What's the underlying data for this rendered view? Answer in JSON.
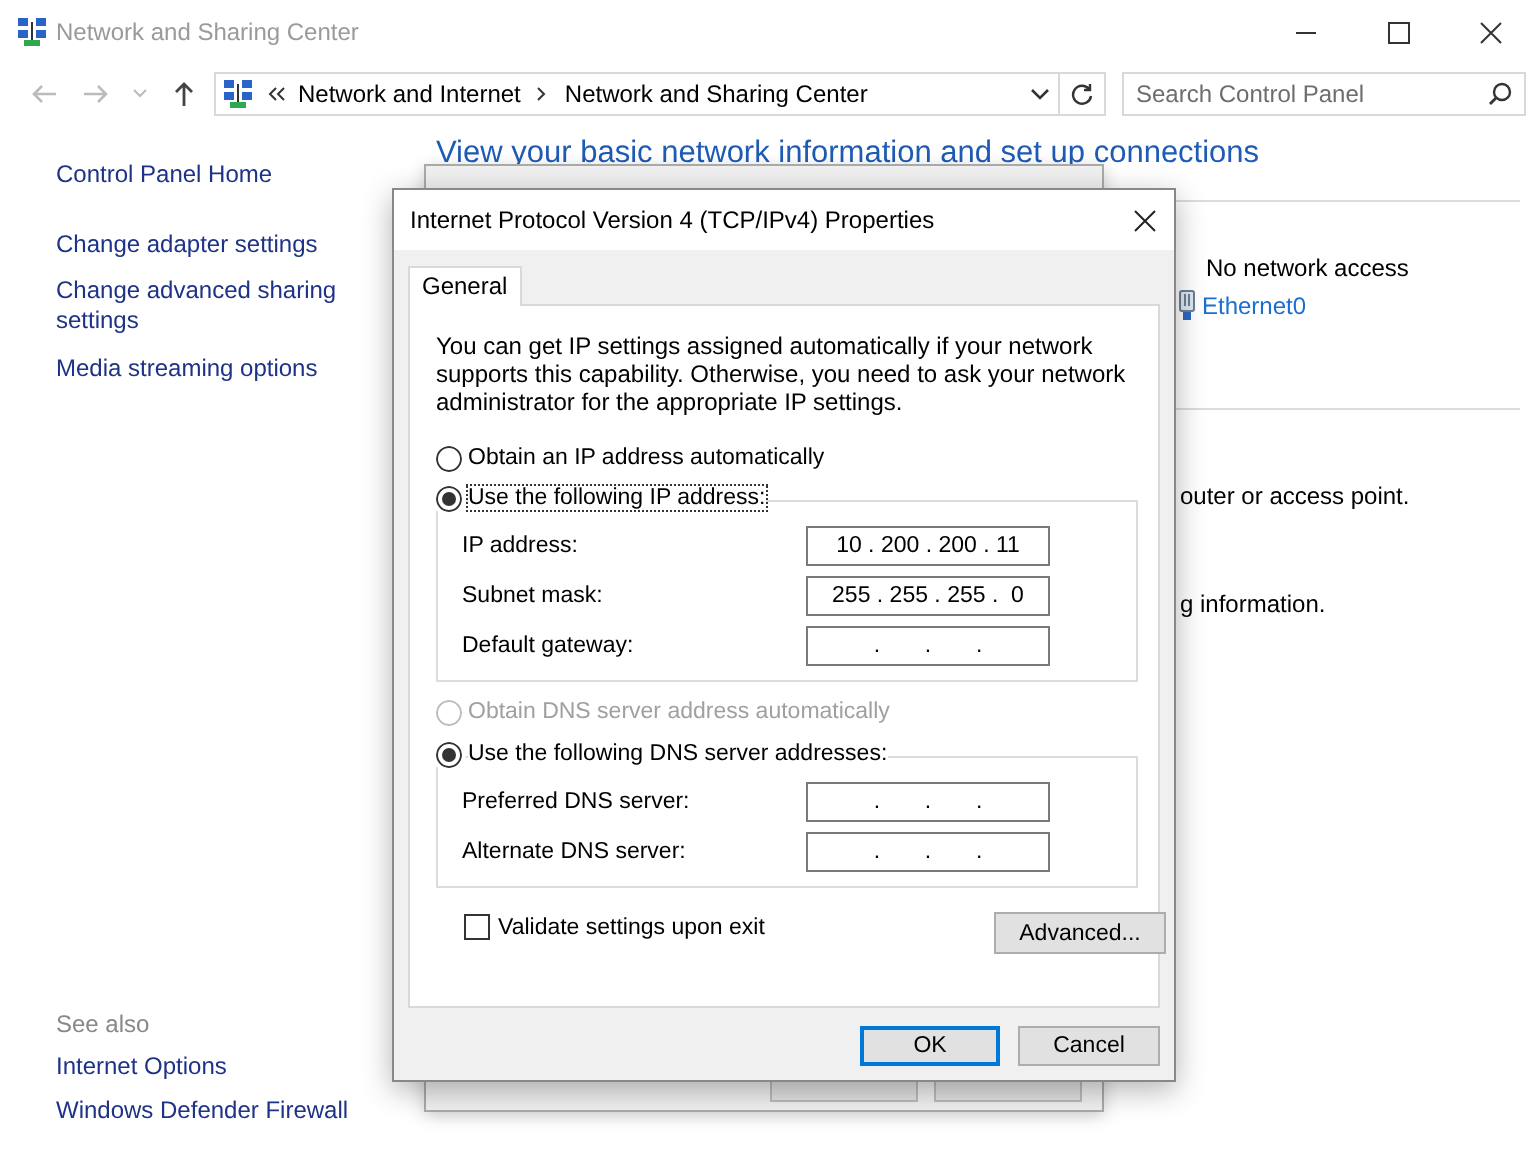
{
  "window": {
    "title": "Network and Sharing Center"
  },
  "address_bar": {
    "path": [
      "Network and Internet",
      "Network and Sharing Center"
    ]
  },
  "search": {
    "placeholder": "Search Control Panel"
  },
  "sidebar": {
    "items": [
      "Control Panel Home",
      "Change adapter settings",
      "Change advanced sharing settings",
      "Media streaming options"
    ],
    "see_also_title": "See also",
    "see_also": [
      "Internet Options",
      "Windows Defender Firewall"
    ]
  },
  "main": {
    "heading": "View your basic network information and set up connections",
    "access_type": "No network access",
    "connection": "Ethernet0",
    "fragments": [
      "outer or access point.",
      "g information."
    ]
  },
  "dialog": {
    "title": "Internet Protocol Version 4 (TCP/IPv4) Properties",
    "tabs": [
      {
        "label": "General",
        "selected": true
      }
    ],
    "intro": "You can get IP settings assigned automatically if your network supports this capability. Otherwise, you need to ask your network administrator for the appropriate IP settings.",
    "ip_auto": {
      "label": "Obtain an IP address automatically",
      "selected": false,
      "disabled": false
    },
    "ip_manual": {
      "label": "Use the following IP address:",
      "selected": true,
      "disabled": false
    },
    "ip_fields": [
      {
        "label": "IP address:",
        "value": "10 . 200 . 200 . 11"
      },
      {
        "label": "Subnet mask:",
        "value": "255 . 255 . 255 .  0"
      },
      {
        "label": "Default gateway:",
        "value": ".       .       ."
      }
    ],
    "dns_auto": {
      "label": "Obtain DNS server address automatically",
      "selected": false,
      "disabled": true
    },
    "dns_manual": {
      "label": "Use the following DNS server addresses:",
      "selected": true,
      "disabled": false
    },
    "dns_fields": [
      {
        "label": "Preferred DNS server:",
        "value": ".       .       ."
      },
      {
        "label": "Alternate DNS server:",
        "value": ".       .       ."
      }
    ],
    "validate": {
      "label": "Validate settings upon exit",
      "checked": false
    },
    "advanced_button": "Advanced...",
    "buttons": [
      {
        "label": "OK",
        "default": true
      },
      {
        "label": "Cancel",
        "default": false
      }
    ]
  }
}
